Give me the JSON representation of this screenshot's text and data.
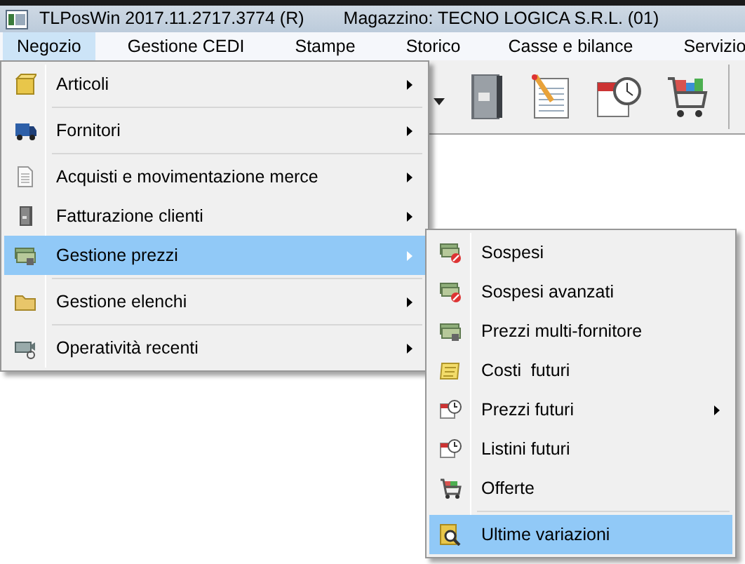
{
  "window": {
    "title": "TLPosWin 2017.11.2717.3774 (R)",
    "subtitle": "Magazzino: TECNO LOGICA S.R.L. (01)"
  },
  "menubar": [
    {
      "label": "Negozio",
      "selected": true
    },
    {
      "label": "Gestione CEDI",
      "selected": false
    },
    {
      "label": "Stampe",
      "selected": false
    },
    {
      "label": "Storico",
      "selected": false
    },
    {
      "label": "Casse e bilance",
      "selected": false
    },
    {
      "label": "Servizio",
      "selected": false
    }
  ],
  "menu": [
    {
      "kind": "item",
      "label": "Articoli",
      "submenu": true,
      "selected": false
    },
    {
      "kind": "separator"
    },
    {
      "kind": "item",
      "label": "Fornitori",
      "submenu": true,
      "selected": false
    },
    {
      "kind": "separator"
    },
    {
      "kind": "item",
      "label": "Acquisti e movimentazione merce",
      "submenu": true,
      "selected": false
    },
    {
      "kind": "item",
      "label": "Fatturazione clienti",
      "submenu": true,
      "selected": false
    },
    {
      "kind": "item",
      "label": "Gestione prezzi",
      "submenu": true,
      "selected": true
    },
    {
      "kind": "separator"
    },
    {
      "kind": "item",
      "label": "Gestione elenchi",
      "submenu": true,
      "selected": false
    },
    {
      "kind": "separator"
    },
    {
      "kind": "item",
      "label": "Operatività recenti",
      "submenu": true,
      "selected": false
    }
  ],
  "submenu": [
    {
      "kind": "item",
      "label": "Sospesi",
      "submenu": false,
      "selected": false
    },
    {
      "kind": "item",
      "label": "Sospesi avanzati",
      "submenu": false,
      "selected": false
    },
    {
      "kind": "item",
      "label": "Prezzi multi-fornitore",
      "submenu": false,
      "selected": false
    },
    {
      "kind": "item",
      "label": "Costi  futuri",
      "submenu": false,
      "selected": false
    },
    {
      "kind": "item",
      "label": "Prezzi futuri",
      "submenu": true,
      "selected": false
    },
    {
      "kind": "item",
      "label": "Listini futuri",
      "submenu": false,
      "selected": false
    },
    {
      "kind": "item",
      "label": "Offerte",
      "submenu": false,
      "selected": false
    },
    {
      "kind": "separator"
    },
    {
      "kind": "item",
      "label": "Ultime variazioni",
      "submenu": false,
      "selected": true
    }
  ]
}
